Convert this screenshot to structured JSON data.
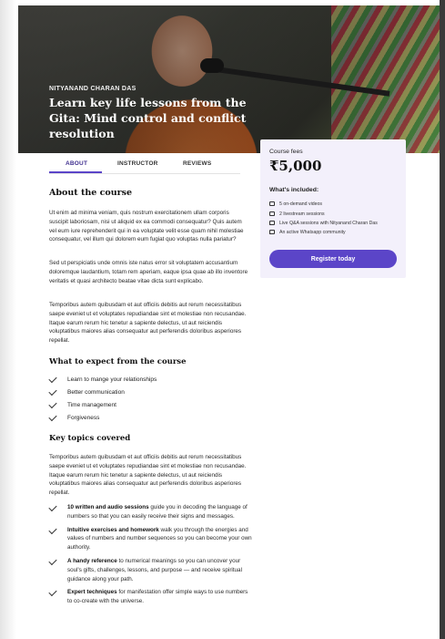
{
  "hero": {
    "eyebrow": "NITYANAND CHARAN DAS",
    "title": "Learn key life lessons from the Gita: Mind control and conflict resolution"
  },
  "tabs": [
    {
      "label": "ABOUT",
      "active": true
    },
    {
      "label": "INSTRUCTOR",
      "active": false
    },
    {
      "label": "REVIEWS",
      "active": false
    }
  ],
  "about": {
    "heading": "About the course",
    "paragraphs": [
      "Ut enim ad minima veniam, quis nostrum exercitationem ullam corporis suscipit laboriosam, nisi ut aliquid ex ea commodi consequatur? Quis autem vel eum iure reprehenderit qui in ea voluptate velit esse quam nihil molestiae consequatur, vel illum qui dolorem eum fugiat quo voluptas nulla pariatur?",
      "Sed ut perspiciatis unde omnis iste natus error sit voluptatem accusantium doloremque laudantium, totam rem aperiam, eaque ipsa quae ab illo inventore veritatis et quasi architecto beatae vitae dicta sunt explicabo.",
      "Temporibus autem quibusdam et aut officiis debitis aut rerum necessitatibus saepe eveniet ut et voluptates repudiandae sint et molestiae non recusandae. Itaque earum rerum hic tenetur a sapiente delectus, ut aut reiciendis voluptatibus maiores alias consequatur aut perferendis doloribus asperiores repellat."
    ]
  },
  "expect": {
    "heading": "What to expect from the course",
    "items": [
      "Learn to mange your relationships",
      "Better communication",
      "Time management",
      "Forgiveness"
    ]
  },
  "topics": {
    "heading": "Key topics covered",
    "intro": "Temporibus autem quibusdam et aut officiis debitis aut rerum necessitatibus saepe eveniet ut et voluptates repudiandae sint et molestiae non recusandae. Itaque earum rerum hic tenetur a sapiente delectus, ut aut reiciendis voluptatibus maiores alias consequatur aut perferendis doloribus asperiores repellat.",
    "items": [
      {
        "bold": "10 written and audio sessions",
        "text": " guide you in decoding the language of numbers so that you can easily receive their signs and messages."
      },
      {
        "bold": "Intuitive exercises and homework",
        "text": " walk you through the energies and values of numbers and number sequences so you can become your own authority."
      },
      {
        "bold": "A handy reference",
        "text": " to numerical meanings so you can uncover your soul's gifts, challenges, lessons, and purpose — and receive spiritual guidance along your path."
      },
      {
        "bold": "Expert techniques",
        "text": " for manifestation offer simple ways to use numbers to co-create with the universe."
      }
    ]
  },
  "card": {
    "fees_label": "Course fees",
    "price": "₹5,000",
    "included_label": "What's included:",
    "features": [
      {
        "icon": "video-icon",
        "text": "5 on-demand videos"
      },
      {
        "icon": "livestream-icon",
        "text": "2 livestream sessions"
      },
      {
        "icon": "chat-icon",
        "text": "Live Q&A sessions with Nityanand Charan Das"
      },
      {
        "icon": "community-icon",
        "text": "An active Whatsapp community"
      }
    ],
    "register_label": "Register today",
    "accent_color": "#5b45c8",
    "background_color": "#f3f0fb"
  }
}
